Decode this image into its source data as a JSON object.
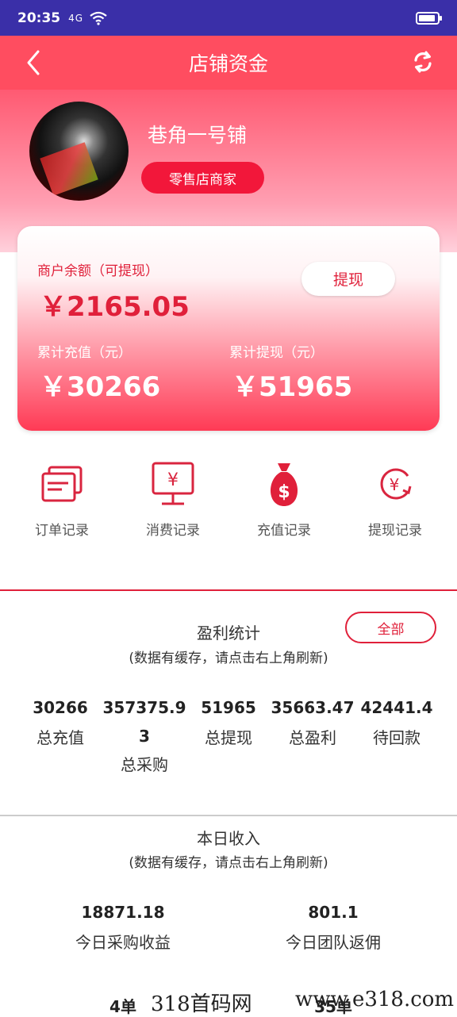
{
  "status_bar": {
    "time": "20:35",
    "signal": "4G"
  },
  "header": {
    "title": "店铺资金"
  },
  "store": {
    "name": "巷角一号铺",
    "type": "零售店商家"
  },
  "balance_card": {
    "balance_label": "商户余额（可提现）",
    "balance_value": "￥2165.05",
    "withdraw_button": "提现",
    "total_recharge_label": "累计充值（元）",
    "total_recharge_value": "￥30266",
    "total_withdraw_label": "累计提现（元）",
    "total_withdraw_value": "￥51965"
  },
  "menu": [
    {
      "label": "订单记录",
      "icon": "order-record-icon"
    },
    {
      "label": "消费记录",
      "icon": "consumption-record-icon"
    },
    {
      "label": "充值记录",
      "icon": "money-bag-icon"
    },
    {
      "label": "提现记录",
      "icon": "withdraw-record-icon"
    }
  ],
  "profit": {
    "title": "盈利统计",
    "note": "(数据有缓存，请点击右上角刷新)",
    "all_button": "全部",
    "stats": [
      {
        "value": "30266",
        "label": "总充值"
      },
      {
        "value": "357375.9",
        "value2": "3",
        "label": "总采购"
      },
      {
        "value": "51965",
        "label": "总提现"
      },
      {
        "value": "35663.47",
        "label": "总盈利"
      },
      {
        "value": "42441.4",
        "label": "待回款"
      }
    ]
  },
  "daily": {
    "title": "本日收入",
    "note": "(数据有缓存，请点击右上角刷新)",
    "stats": [
      {
        "value": "18871.18",
        "label": "今日采购收益"
      },
      {
        "value": "801.1",
        "label": "今日团队返佣"
      }
    ],
    "partial_left": "4单",
    "partial_right": "35单"
  },
  "watermark": {
    "left": "318首码网",
    "right": "www.e318.com"
  },
  "colors": {
    "primary": "#ff4d60",
    "accent": "#e0203a",
    "status_bar": "#3a2fa8"
  }
}
